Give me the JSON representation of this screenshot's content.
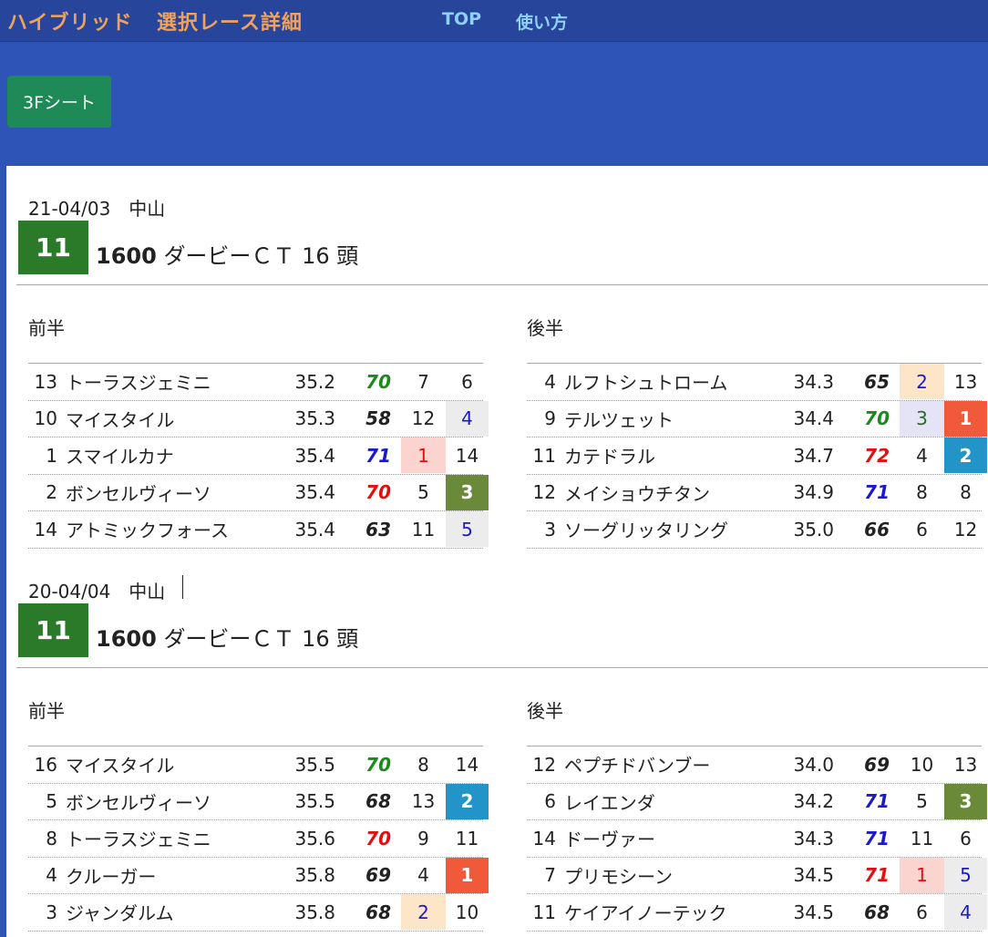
{
  "header": {
    "title1": "ハイブリッド",
    "title2": "選択レース詳細",
    "nav_top": "TOP",
    "nav_help": "使い方"
  },
  "sheet_button": "3Fシート",
  "halves": {
    "first": "前半",
    "second": "後半"
  },
  "colors": {
    "score_green": "#1a8a1a",
    "score_black": "#222222",
    "score_blue": "#1a1acc",
    "score_red": "#e01010",
    "rank1": "#f05a3a",
    "rank2": "#2394c8",
    "rank3": "#6a8a3a",
    "rank_pink": "#fbd4d0",
    "rank_peach": "#fde6c8",
    "rank_lavender": "#e4e4f6",
    "rank_gray": "#ececec"
  },
  "races": [
    {
      "date": "21-04/03　中山",
      "race_no": "11",
      "distance": "1600",
      "race_name": "ダービーＣＴ",
      "heads": "16 頭",
      "first_half": [
        {
          "no": "13",
          "name": "トーラスジェミニ",
          "time": "35.2",
          "score": "70",
          "score_color": "green",
          "r1": "7",
          "r1_style": "none",
          "r2": "6",
          "r2_style": "none"
        },
        {
          "no": "10",
          "name": "マイスタイル",
          "time": "35.3",
          "score": "58",
          "score_color": "black",
          "r1": "12",
          "r1_style": "none",
          "r2": "4",
          "r2_style": "gray"
        },
        {
          "no": "1",
          "name": "スマイルカナ",
          "time": "35.4",
          "score": "71",
          "score_color": "blue",
          "r1": "1",
          "r1_style": "pink",
          "r2": "14",
          "r2_style": "none"
        },
        {
          "no": "2",
          "name": "ボンセルヴィーソ",
          "time": "35.4",
          "score": "70",
          "score_color": "red",
          "r1": "5",
          "r1_style": "none",
          "r2": "3",
          "r2_style": "rank3"
        },
        {
          "no": "14",
          "name": "アトミックフォース",
          "time": "35.4",
          "score": "63",
          "score_color": "black",
          "r1": "11",
          "r1_style": "none",
          "r2": "5",
          "r2_style": "gray"
        }
      ],
      "second_half": [
        {
          "no": "4",
          "name": "ルフトシュトローム",
          "time": "34.3",
          "score": "65",
          "score_color": "black",
          "r1": "2",
          "r1_style": "peach",
          "r2": "13",
          "r2_style": "none"
        },
        {
          "no": "9",
          "name": "テルツェット",
          "time": "34.4",
          "score": "70",
          "score_color": "green",
          "r1": "3",
          "r1_style": "lavender",
          "r2": "1",
          "r2_style": "rank1"
        },
        {
          "no": "11",
          "name": "カテドラル",
          "time": "34.7",
          "score": "72",
          "score_color": "red",
          "r1": "4",
          "r1_style": "none",
          "r2": "2",
          "r2_style": "rank2"
        },
        {
          "no": "12",
          "name": "メイショウチタン",
          "time": "34.9",
          "score": "71",
          "score_color": "blue",
          "r1": "8",
          "r1_style": "none",
          "r2": "8",
          "r2_style": "none"
        },
        {
          "no": "3",
          "name": "ソーグリッタリング",
          "time": "35.0",
          "score": "66",
          "score_color": "black",
          "r1": "6",
          "r1_style": "none",
          "r2": "12",
          "r2_style": "none"
        }
      ]
    },
    {
      "date": "20-04/04　中山",
      "race_no": "11",
      "distance": "1600",
      "race_name": "ダービーＣＴ",
      "heads": "16 頭",
      "first_half": [
        {
          "no": "16",
          "name": "マイスタイル",
          "time": "35.5",
          "score": "70",
          "score_color": "green",
          "r1": "8",
          "r1_style": "none",
          "r2": "14",
          "r2_style": "none"
        },
        {
          "no": "5",
          "name": "ボンセルヴィーソ",
          "time": "35.5",
          "score": "68",
          "score_color": "black",
          "r1": "13",
          "r1_style": "none",
          "r2": "2",
          "r2_style": "rank2"
        },
        {
          "no": "8",
          "name": "トーラスジェミニ",
          "time": "35.6",
          "score": "70",
          "score_color": "red",
          "r1": "9",
          "r1_style": "none",
          "r2": "11",
          "r2_style": "none"
        },
        {
          "no": "4",
          "name": "クルーガー",
          "time": "35.8",
          "score": "69",
          "score_color": "black",
          "r1": "4",
          "r1_style": "none",
          "r2": "1",
          "r2_style": "rank1"
        },
        {
          "no": "3",
          "name": "ジャンダルム",
          "time": "35.8",
          "score": "68",
          "score_color": "black",
          "r1": "2",
          "r1_style": "peach",
          "r2": "10",
          "r2_style": "none"
        }
      ],
      "second_half": [
        {
          "no": "12",
          "name": "ペプチドバンブー",
          "time": "34.0",
          "score": "69",
          "score_color": "black",
          "r1": "10",
          "r1_style": "none",
          "r2": "13",
          "r2_style": "none"
        },
        {
          "no": "6",
          "name": "レイエンダ",
          "time": "34.2",
          "score": "71",
          "score_color": "blue",
          "r1": "5",
          "r1_style": "none",
          "r2": "3",
          "r2_style": "rank3"
        },
        {
          "no": "14",
          "name": "ドーヴァー",
          "time": "34.3",
          "score": "71",
          "score_color": "blue",
          "r1": "11",
          "r1_style": "none",
          "r2": "6",
          "r2_style": "none"
        },
        {
          "no": "7",
          "name": "プリモシーン",
          "time": "34.5",
          "score": "71",
          "score_color": "red",
          "r1": "1",
          "r1_style": "pink",
          "r2": "5",
          "r2_style": "gray"
        },
        {
          "no": "11",
          "name": "ケイアイノーテック",
          "time": "34.5",
          "score": "68",
          "score_color": "black",
          "r1": "6",
          "r1_style": "none",
          "r2": "4",
          "r2_style": "gray"
        }
      ]
    }
  ]
}
